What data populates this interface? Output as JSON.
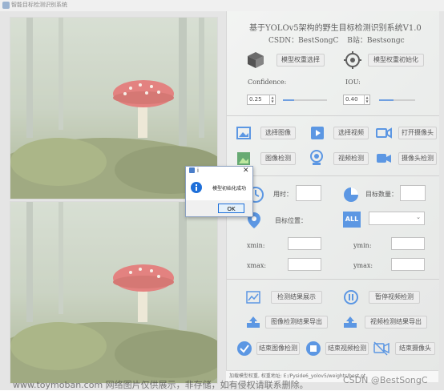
{
  "window": {
    "title": "智能目标检测识别系统"
  },
  "header": {
    "title": "基于YOLOv5架构的野生目标检测识别系统V1.0",
    "author_line_csdn_label": "CSDN：",
    "author_line_csdn_value": "BestSongC",
    "author_line_b_label": "B站：",
    "author_line_b_value": "Bestsongc"
  },
  "model": {
    "select_button": "模型权重选择",
    "init_button": "模型权重初始化"
  },
  "params": {
    "confidence_label": "Confidence:",
    "confidence_value": "0.25",
    "confidence_level": 0.25,
    "iou_label": "IOU:",
    "iou_value": "0.40",
    "iou_level": 0.4
  },
  "actions": {
    "select_image": "选择图像",
    "select_video": "选择视频",
    "open_camera": "打开摄像头",
    "image_detect": "图像检测",
    "video_detect": "视频检测",
    "camera_detect": "摄像头检测"
  },
  "stats": {
    "time_label": "用时：",
    "count_label": "目标数量：",
    "position_label": "目标位置：",
    "all_icon_text": "ALL",
    "xmin_label": "xmin:",
    "ymin_label": "ymin:",
    "xmax_label": "xmax:",
    "ymax_label": "ymax:"
  },
  "results": {
    "show_results": "检测结果展示",
    "pause_video": "暂停视频检测",
    "export_image": "图像检测结果导出",
    "export_video": "视频检测结果导出",
    "end_image": "结束图像检测",
    "end_video": "结束视频检测",
    "end_camera": "结束摄像头"
  },
  "dialog": {
    "title": "i",
    "message": "模型初始化成功",
    "ok": "OK"
  },
  "statusbar": {
    "text": "加载模型权重, 权重地址: E:/Pyside6_yolov5/weights/best.pt"
  },
  "watermark": {
    "text": "www.toymoban.com 网络图片仅供展示，非存储，如有侵权请联系删除。",
    "csdn": "CSDN @BestSongC"
  },
  "colors": {
    "accent": "#1e6fd9",
    "panel": "#e6e8e6"
  }
}
